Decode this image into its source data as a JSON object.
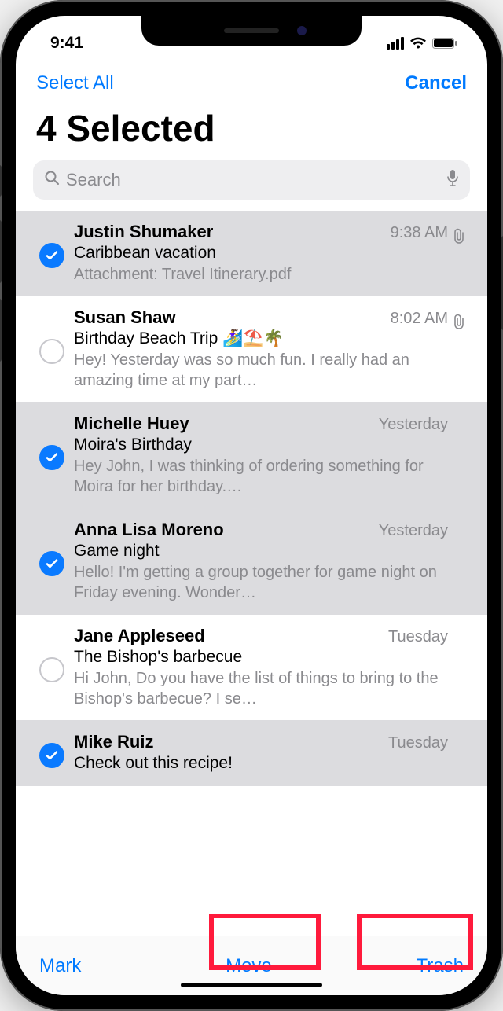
{
  "status": {
    "time": "9:41"
  },
  "nav": {
    "select_all": "Select All",
    "cancel": "Cancel"
  },
  "title": "4 Selected",
  "search": {
    "placeholder": "Search"
  },
  "toolbar": {
    "mark": "Mark",
    "move": "Move",
    "trash": "Trash"
  },
  "rows": [
    {
      "selected": true,
      "sender": "Justin Shumaker",
      "when": "9:38 AM",
      "subject": "Caribbean vacation",
      "preview": "Attachment: Travel Itinerary.pdf",
      "attachment": true
    },
    {
      "selected": false,
      "sender": "Susan Shaw",
      "when": "8:02 AM",
      "subject": "Birthday Beach Trip 🏄‍♀️⛱️🌴",
      "preview": "Hey! Yesterday was so much fun. I really had an amazing time at my part…",
      "attachment": true
    },
    {
      "selected": true,
      "sender": "Michelle Huey",
      "when": "Yesterday",
      "subject": "Moira's Birthday",
      "preview": "Hey John, I was thinking of ordering something for Moira for her birthday.…",
      "attachment": false
    },
    {
      "selected": true,
      "sender": "Anna Lisa Moreno",
      "when": "Yesterday",
      "subject": "Game night",
      "preview": "Hello! I'm getting a group together for game night on Friday evening. Wonder…",
      "attachment": false
    },
    {
      "selected": false,
      "sender": "Jane Appleseed",
      "when": "Tuesday",
      "subject": "The Bishop's barbecue",
      "preview": "Hi John, Do you have the list of things to bring to the Bishop's barbecue? I se…",
      "attachment": false
    },
    {
      "selected": true,
      "sender": "Mike Ruiz",
      "when": "Tuesday",
      "subject": "Check out this recipe!",
      "preview": "",
      "attachment": false
    }
  ]
}
